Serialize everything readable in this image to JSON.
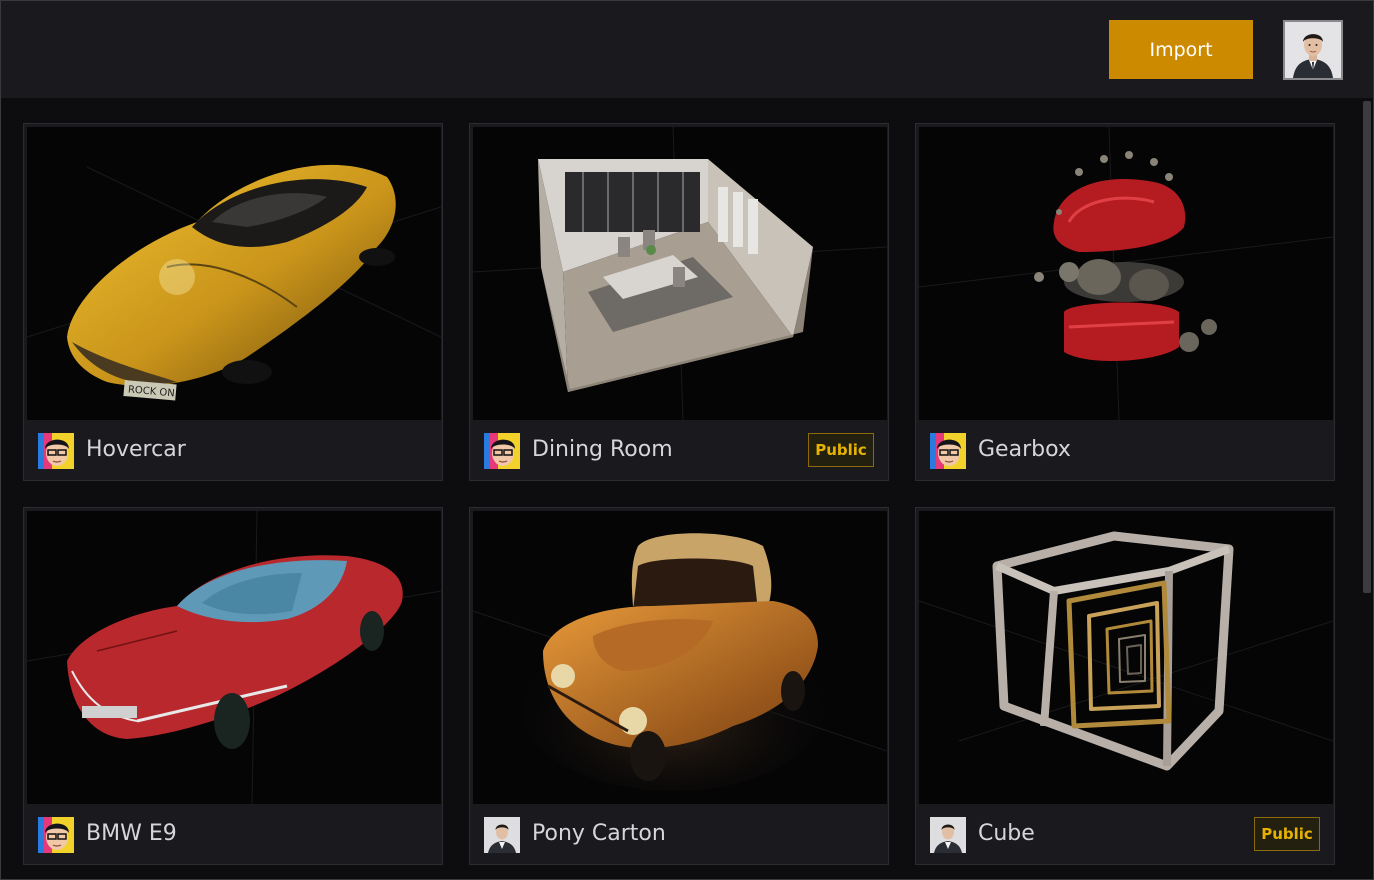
{
  "header": {
    "import_label": "Import",
    "user_avatar_icon": "user-avatar-icon"
  },
  "theme": {
    "background": "#0d0d0f",
    "header_bg": "#1a1a1e",
    "card_bg": "#1a1a1e",
    "accent": "#cc8a00",
    "badge_text": "#e6b400",
    "badge_border": "#8a6a0a"
  },
  "models": [
    {
      "title": "Hovercar",
      "owner_icon": "anime-avatar-icon",
      "badge": ""
    },
    {
      "title": "Dining Room",
      "owner_icon": "anime-avatar-icon",
      "badge": "Public"
    },
    {
      "title": "Gearbox",
      "owner_icon": "anime-avatar-icon",
      "badge": ""
    },
    {
      "title": "BMW E9",
      "owner_icon": "anime-avatar-icon",
      "badge": ""
    },
    {
      "title": "Pony Carton",
      "owner_icon": "photo-avatar-icon",
      "badge": ""
    },
    {
      "title": "Cube",
      "owner_icon": "photo-avatar-icon",
      "badge": "Public"
    }
  ]
}
